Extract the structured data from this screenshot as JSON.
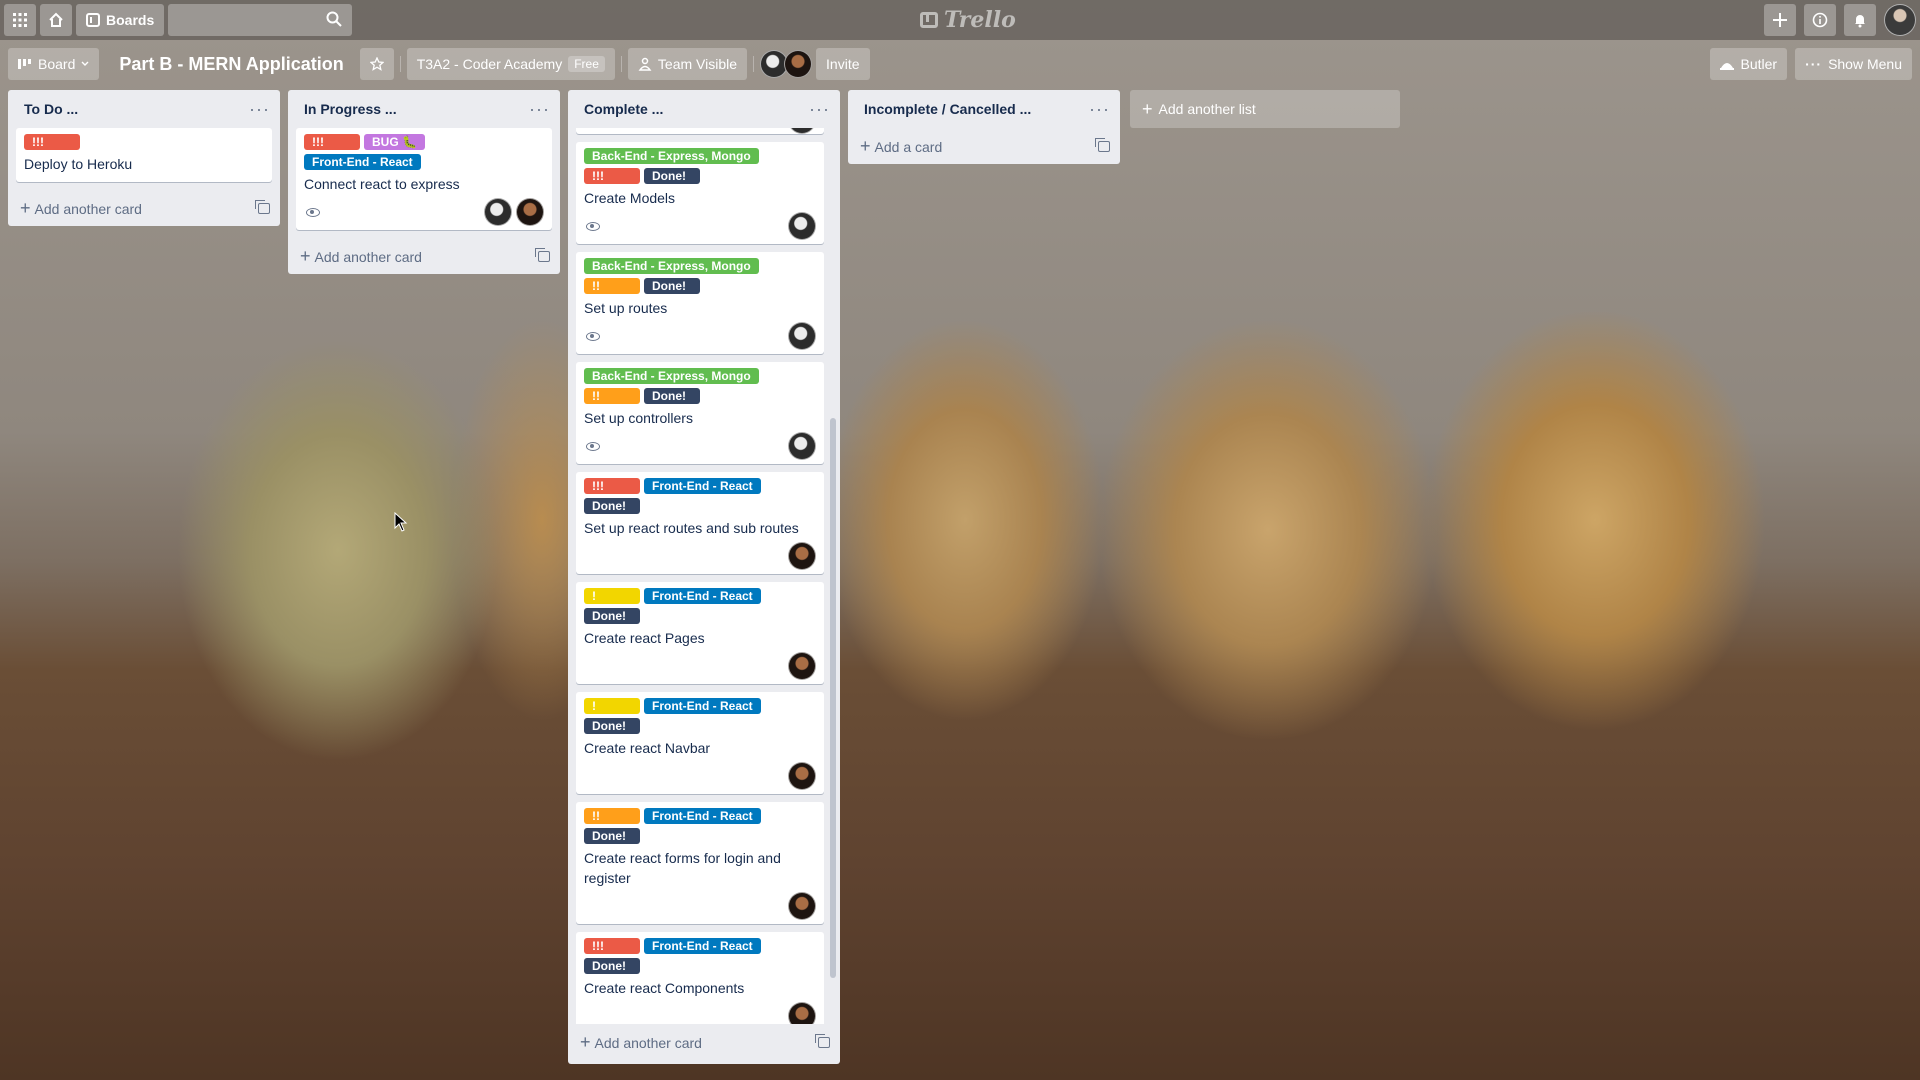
{
  "header": {
    "boards_label": "Boards",
    "search_placeholder": "",
    "logo_text": "Trello"
  },
  "board": {
    "view_label": "Board",
    "title": "Part B - MERN Application",
    "workspace": "T3A2 - Coder Academy",
    "workspace_badge": "Free",
    "visibility": "Team Visible",
    "invite_label": "Invite",
    "butler_label": "Butler",
    "show_menu_label": "Show Menu"
  },
  "labels_colors": {
    "red": "#eb5a46",
    "orange": "#ff9f1a",
    "yellow": "#f2d600",
    "green": "#61bd4f",
    "blue": "#0079bf",
    "purple": "#c377e0",
    "navy": "#344563"
  },
  "lists": {
    "todo": {
      "title": "To Do ...",
      "add_card": "Add another card",
      "cards": [
        {
          "labels": [
            {
              "text": "!!!",
              "color": "red"
            }
          ],
          "title": "Deploy to Heroku"
        }
      ]
    },
    "inprogress": {
      "title": "In Progress ...",
      "add_card": "Add another card",
      "cards": [
        {
          "labels": [
            {
              "text": "!!!",
              "color": "red"
            },
            {
              "text": "BUG 🐛",
              "color": "purple"
            },
            {
              "text": "Front-End - React",
              "color": "blue"
            }
          ],
          "title": "Connect react to express"
        }
      ]
    },
    "complete": {
      "title": "Complete ...",
      "add_card": "Add another card",
      "cards": [
        {
          "labels": [
            {
              "text": "Back-End - Express, Mongo",
              "color": "green"
            },
            {
              "text": "!!!",
              "color": "red"
            },
            {
              "text": "Done!",
              "color": "navy"
            }
          ],
          "title": "Create Models"
        },
        {
          "labels": [
            {
              "text": "Back-End - Express, Mongo",
              "color": "green"
            },
            {
              "text": "!!",
              "color": "orange"
            },
            {
              "text": "Done!",
              "color": "navy"
            }
          ],
          "title": "Set up routes"
        },
        {
          "labels": [
            {
              "text": "Back-End - Express, Mongo",
              "color": "green"
            },
            {
              "text": "!!",
              "color": "orange"
            },
            {
              "text": "Done!",
              "color": "navy"
            }
          ],
          "title": "Set up controllers"
        },
        {
          "labels": [
            {
              "text": "!!!",
              "color": "red"
            },
            {
              "text": "Front-End - React",
              "color": "blue"
            },
            {
              "text": "Done!",
              "color": "navy"
            }
          ],
          "title": "Set up react routes and sub routes"
        },
        {
          "labels": [
            {
              "text": "!",
              "color": "yellow"
            },
            {
              "text": "Front-End - React",
              "color": "blue"
            },
            {
              "text": "Done!",
              "color": "navy"
            }
          ],
          "title": "Create react Pages"
        },
        {
          "labels": [
            {
              "text": "!",
              "color": "yellow"
            },
            {
              "text": "Front-End - React",
              "color": "blue"
            },
            {
              "text": "Done!",
              "color": "navy"
            }
          ],
          "title": "Create react Navbar"
        },
        {
          "labels": [
            {
              "text": "!!",
              "color": "orange"
            },
            {
              "text": "Front-End - React",
              "color": "blue"
            },
            {
              "text": "Done!",
              "color": "navy"
            }
          ],
          "title": "Create react forms for login and register"
        },
        {
          "labels": [
            {
              "text": "!!!",
              "color": "red"
            },
            {
              "text": "Front-End - React",
              "color": "blue"
            },
            {
              "text": "Done!",
              "color": "navy"
            }
          ],
          "title": "Create react Components"
        }
      ]
    },
    "cancelled": {
      "title": "Incomplete / Cancelled ...",
      "add_card": "Add a card",
      "cards": []
    }
  },
  "add_list_label": "Add another list"
}
